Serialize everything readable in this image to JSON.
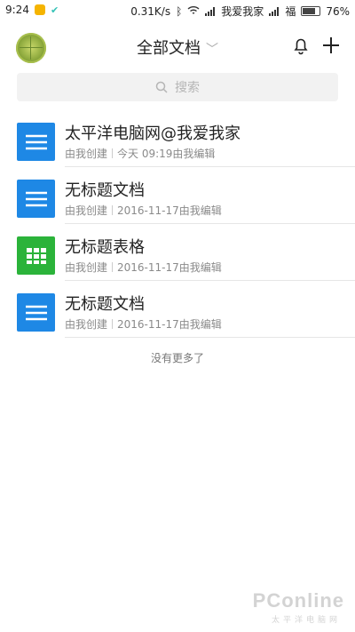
{
  "status_bar": {
    "time": "9:24",
    "net_speed": "0.31K/s",
    "carrier1": "我爱我家",
    "carrier2": "福",
    "battery": "76%"
  },
  "header": {
    "title": "全部文档"
  },
  "search": {
    "placeholder": "搜索"
  },
  "documents": [
    {
      "type": "doc",
      "name": "太平洋电脑网@我爱我家",
      "creator": "由我创建",
      "edited": "今天 09:19由我编辑"
    },
    {
      "type": "doc",
      "name": "无标题文档",
      "creator": "由我创建",
      "edited": "2016-11-17由我编辑"
    },
    {
      "type": "sheet",
      "name": "无标题表格",
      "creator": "由我创建",
      "edited": "2016-11-17由我编辑"
    },
    {
      "type": "doc",
      "name": "无标题文档",
      "creator": "由我创建",
      "edited": "2016-11-17由我编辑"
    }
  ],
  "footer": {
    "no_more": "没有更多了"
  },
  "watermark": {
    "brand": "PConline",
    "sub": "太平洋电脑网"
  },
  "colors": {
    "doc_blue": "#1e88e5",
    "sheet_green": "#2bb33a"
  }
}
